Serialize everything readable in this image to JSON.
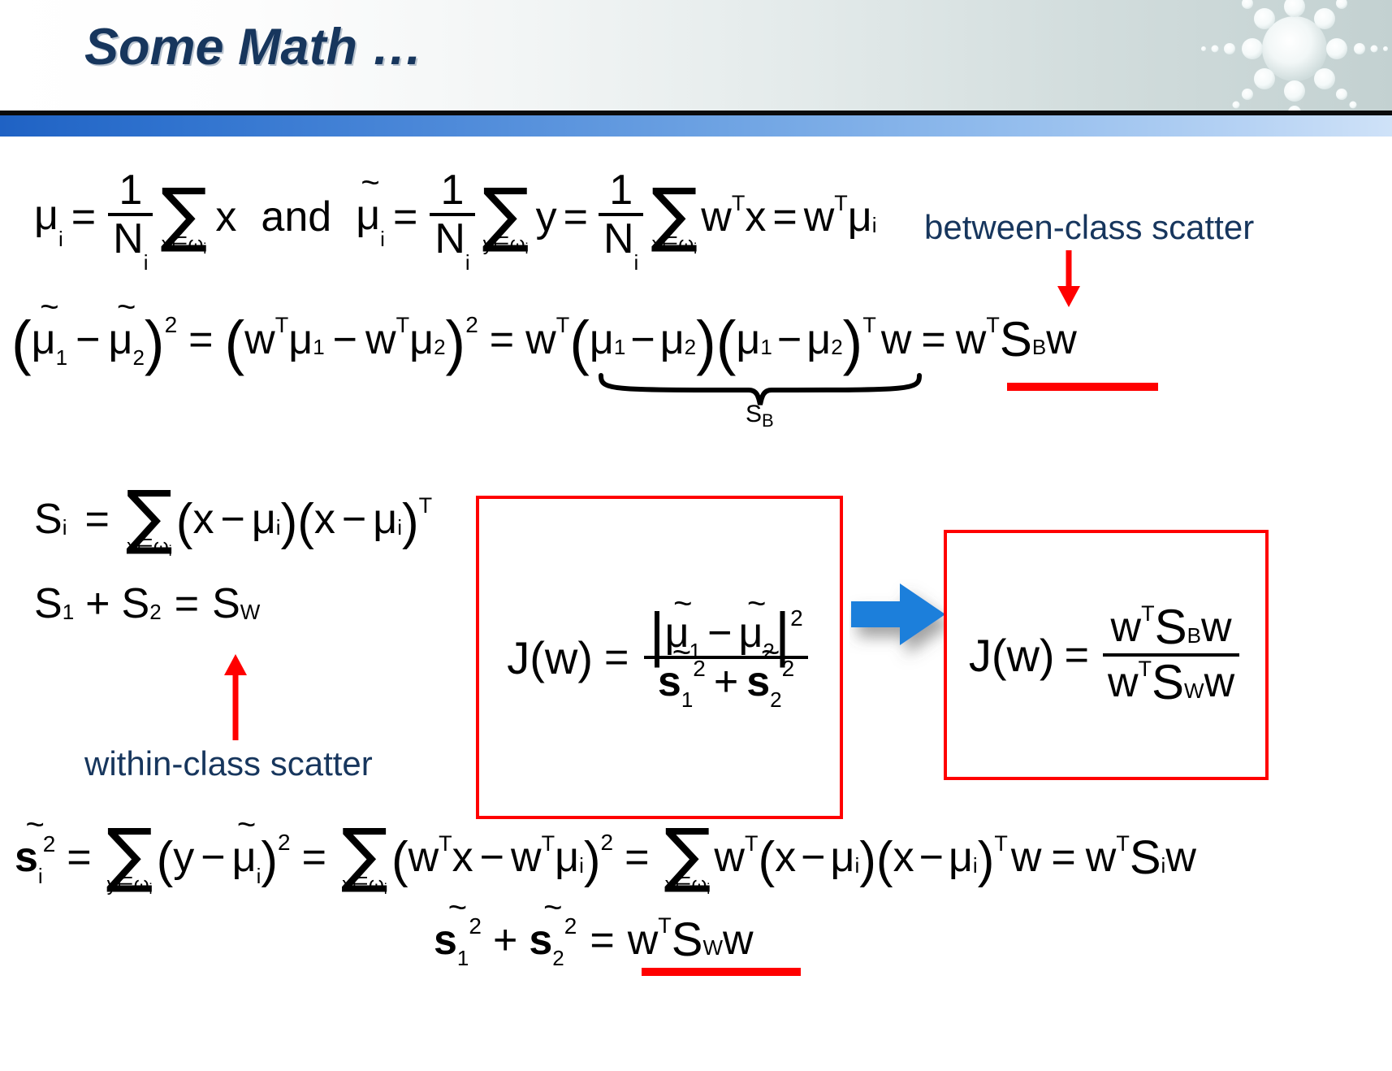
{
  "slide": {
    "title": "Some Math …",
    "decoration": "sunburst-logo"
  },
  "theme": {
    "title_color": "#17365d",
    "accent_bar_color": "#2f72ce",
    "annotation_red": "#ff0000",
    "label_blue": "#17365d",
    "arrow_blue": "#1f7fdb",
    "box_border": "#ff0000",
    "background": "#ffffff"
  },
  "labels": {
    "between_class": "between-class scatter",
    "within_class": "within-class scatter"
  },
  "equations": {
    "row1": {
      "mu_lhs": "μ",
      "mu_sub": "i",
      "eq1": "=",
      "one": "1",
      "N": "N",
      "N_sub": "i",
      "sum": "∑",
      "sum_lim_x": "x∈ω",
      "sum_lim_x_sub": "i",
      "x": "x",
      "and": "and",
      "mu_tilde": "μ",
      "tilde_mark": "~",
      "sum_lim_y": "y∈ω",
      "y": "y",
      "w": "w",
      "T": "T",
      "mu_i": "μ"
    },
    "row2": {
      "lhs_open": "(",
      "mu1": "μ",
      "s1": "1",
      "minus": "−",
      "mu2": "μ",
      "s2": "2",
      "close": ")",
      "sq": "2",
      "eq": "=",
      "w": "w",
      "T": "T",
      "SB": "S",
      "SB_sub": "B",
      "brace_label": "S",
      "brace_label_sub": "B"
    },
    "row3": {
      "S": "S",
      "S_sub": "i",
      "eq": "=",
      "sum": "∑",
      "lim": "x∈ω",
      "lim_sub": "i",
      "x": "x",
      "minus": "−",
      "mu": "μ",
      "mu_sub": "i",
      "T": "T"
    },
    "row4": {
      "S1": "S",
      "one": "1",
      "plus": "+",
      "S2": "S",
      "two": "2",
      "eq": "=",
      "SW": "S",
      "W": "W"
    },
    "box1": {
      "J": "J(w)",
      "eq": "=",
      "num_mu1": "μ",
      "num_s1": "1",
      "minus": "−",
      "num_mu2": "μ",
      "num_s2": "2",
      "num_pow": "2",
      "den_s1": "s",
      "den_s1_sub": "1",
      "den_s1_sup": "2",
      "plus": "+",
      "den_s2": "s",
      "den_s2_sub": "2",
      "den_s2_sup": "2"
    },
    "box2": {
      "J": "J(w)",
      "eq": "=",
      "w": "w",
      "T": "T",
      "SB": "S",
      "SB_sub": "B",
      "SW": "S",
      "SW_sub": "W"
    },
    "row5": {
      "s": "s",
      "s_sub": "i",
      "s_sup": "2",
      "eq": "=",
      "sum": "∑",
      "lim_y": "y∈ω",
      "lim_x": "x∈ω",
      "lim_sub": "i",
      "y": "y",
      "minus": "−",
      "mu": "μ",
      "mu_sub": "i",
      "pow2": "2",
      "w": "w",
      "T": "T",
      "x": "x",
      "Si": "S",
      "Si_sub": "i"
    },
    "row6": {
      "s1": "s",
      "s1_sub": "1",
      "s1_sup": "2",
      "plus": "+",
      "s2": "s",
      "s2_sub": "2",
      "s2_sup": "2",
      "eq": "=",
      "w": "w",
      "T": "T",
      "SW": "S",
      "SW_sub": "W"
    }
  }
}
